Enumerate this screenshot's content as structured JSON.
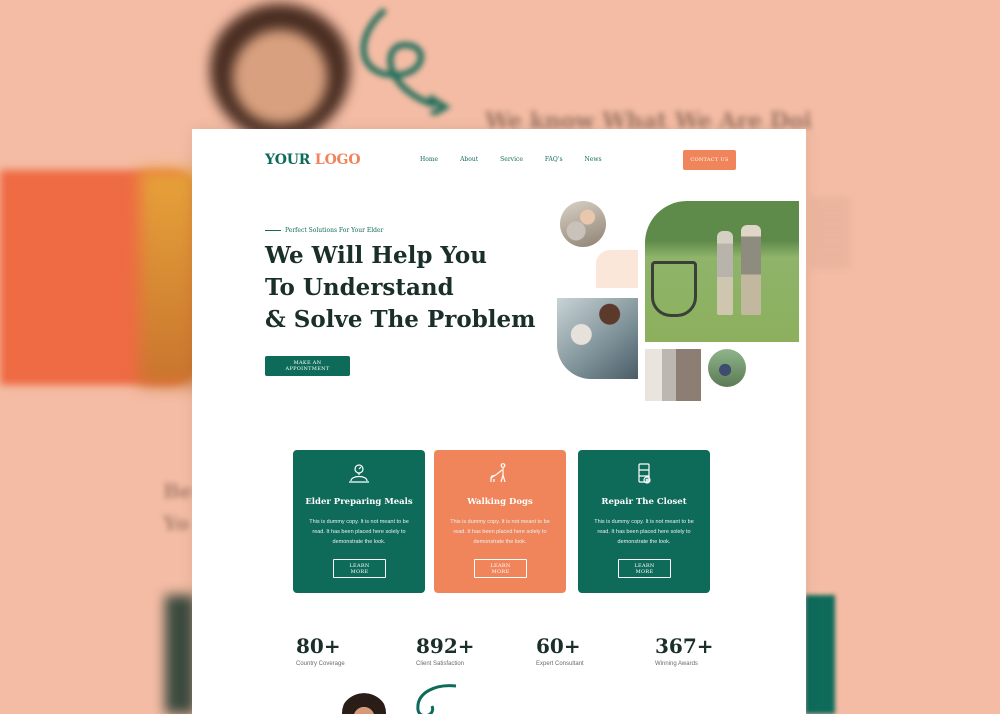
{
  "background": {
    "blurred_heading": "We know What We Are Doi",
    "blurred_left_text": [
      "Be",
      "Yo"
    ]
  },
  "header": {
    "logo_part1": "YOUR",
    "logo_part2": "LOGO",
    "nav": [
      "Home",
      "About",
      "Service",
      "FAQ's",
      "News"
    ],
    "contact_label": "CONTACT US"
  },
  "hero": {
    "kicker": "Perfect Solutions For Your Elder",
    "title_lines": [
      "We Will Help You",
      "To Understand",
      "& Solve The Problem"
    ],
    "button_label": "MAKE AN APPOINTMENT"
  },
  "features": [
    {
      "title": "Elder Preparing Meals",
      "text": "This is dummy copy. It is not meant to be read. It has been placed here solely to demonstrate the look.",
      "button": "LEARN MORE",
      "icon": "meal-cloche-icon"
    },
    {
      "title": "Walking Dogs",
      "text": "This is dummy copy. It is not meant to be read. It has been placed here solely to demonstrate the look.",
      "button": "LEARN MORE",
      "icon": "dog-walking-icon"
    },
    {
      "title": "Repair The Closet",
      "text": "This is dummy copy. It is not meant to be read. It has been placed here solely to demonstrate the look.",
      "button": "LEARN MORE",
      "icon": "closet-repair-icon"
    }
  ],
  "stats": [
    {
      "value": "80+",
      "label": "Country Coverage"
    },
    {
      "value": "892+",
      "label": "Client Satisfaction"
    },
    {
      "value": "60+",
      "label": "Expert Consultant"
    },
    {
      "value": "367+",
      "label": "Winning Awards"
    }
  ],
  "colors": {
    "brand_green": "#0e6b5a",
    "brand_orange": "#f0845a",
    "background_peach": "#f4bca4",
    "heading_dark": "#1b2f2a"
  }
}
